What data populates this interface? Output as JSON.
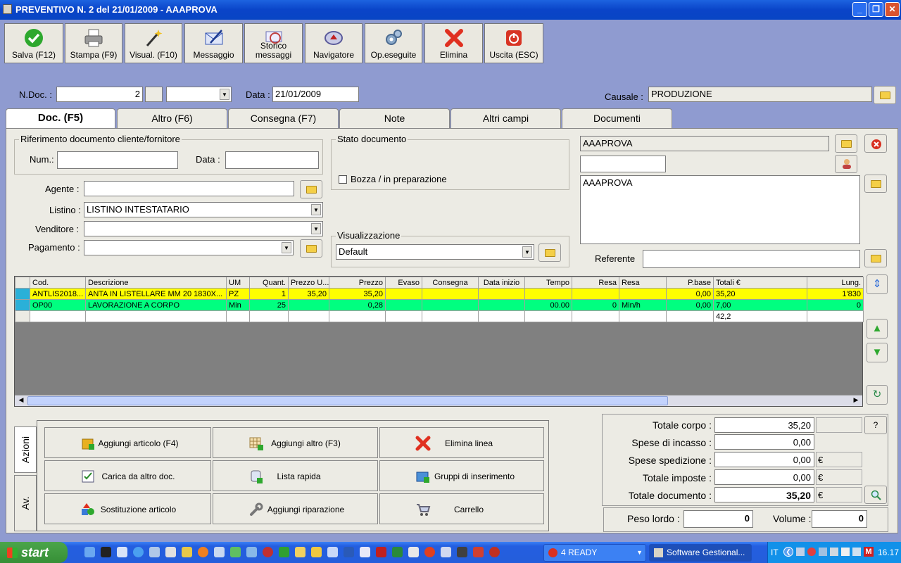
{
  "window": {
    "title": "PREVENTIVO N. 2  del 21/01/2009 - AAAPROVA",
    "min": "_",
    "max": "❐",
    "close": "✕"
  },
  "toolbar": [
    {
      "label": "Salva (F12)",
      "icon": "check-icon",
      "color": "#2ea82e"
    },
    {
      "label": "Stampa (F9)",
      "icon": "printer-icon",
      "color": "#6a6a6a"
    },
    {
      "label": "Visual. (F10)",
      "icon": "magic-wand-icon",
      "color": "#b08a18"
    },
    {
      "label": "Messaggio",
      "icon": "envelope-icon",
      "color": "#3656b5"
    },
    {
      "label": "Storico messaggi",
      "icon": "history-envelope-icon",
      "color": "#6a6fb5"
    },
    {
      "label": "Navigatore",
      "icon": "compass-icon",
      "color": "#5a5a9a"
    },
    {
      "label": "Op.eseguite",
      "icon": "gears-icon",
      "color": "#5078a8"
    },
    {
      "label": "Elimina",
      "icon": "x-icon",
      "color": "#e03020"
    },
    {
      "label": "Uscita (ESC)",
      "icon": "power-icon",
      "color": "#d83424"
    }
  ],
  "header": {
    "ndoc_label": "N.Doc. :",
    "ndoc_value": "2",
    "data_label": "Data :",
    "data_value": "21/01/2009",
    "causale_label": "Causale :",
    "causale_value": "PRODUZIONE"
  },
  "tabs": [
    "Doc. (F5)",
    "Altro (F6)",
    "Consegna (F7)",
    "Note",
    "Altri campi",
    "Documenti"
  ],
  "riferimento": {
    "title": "Riferimento documento cliente/fornitore",
    "num_label": "Num.:",
    "data_label": "Data :"
  },
  "stato": {
    "title": "Stato documento",
    "bozza_label": "Bozza / in preparazione"
  },
  "visualizzazione": {
    "title": "Visualizzazione",
    "value": "Default"
  },
  "fields": {
    "agente_label": "Agente :",
    "listino_label": "Listino :",
    "listino_value": "LISTINO INTESTATARIO",
    "venditore_label": "Venditore :",
    "pagamento_label": "Pagamento :"
  },
  "cliente": {
    "name": "AAAPROVA",
    "address": "AAAPROVA",
    "referente_label": "Referente"
  },
  "grid": {
    "columns": [
      "Cod.",
      "Descrizione",
      "UM",
      "Quant.",
      "Prezzo U...",
      "Prezzo",
      "Evaso",
      "Consegna",
      "Data inizio",
      "Tempo",
      "Resa",
      "Resa",
      "P.base",
      "Totali €",
      "Lung."
    ],
    "rows": [
      [
        "ANTLIS2018...",
        "ANTA IN LISTELLARE MM 20 1830X...",
        "PZ",
        "1",
        "35,20",
        "35,20",
        "",
        "",
        "",
        "",
        "",
        "",
        "0,00",
        "35,20",
        "1'830"
      ],
      [
        "OP00",
        "LAVORAZIONE A CORPO",
        "Min",
        "25",
        "",
        "0,28",
        "",
        "",
        "",
        "00.00",
        "0",
        "Min/h",
        "0,00",
        "7,00",
        "0"
      ],
      [
        "",
        "",
        "",
        "",
        "",
        "",
        "",
        "",
        "",
        "",
        "",
        "",
        "",
        "42,2",
        ""
      ]
    ]
  },
  "actions": {
    "tab_azioni": "Azioni",
    "tab_av": "Av.",
    "buttons": [
      {
        "label": "Aggiungi articolo (F4)",
        "icon": "box-add-icon"
      },
      {
        "label": "Aggiungi altro (F3)",
        "icon": "grid-add-icon"
      },
      {
        "label": "Elimina linea",
        "icon": "x-icon"
      },
      {
        "label": "Carica da altro doc.",
        "icon": "checklist-icon"
      },
      {
        "label": "Lista rapida",
        "icon": "scroll-add-icon"
      },
      {
        "label": "Gruppi di inserimento",
        "icon": "group-add-icon"
      },
      {
        "label": "Sostituzione articolo",
        "icon": "shapes-icon"
      },
      {
        "label": "Aggiungi riparazione",
        "icon": "wrench-icon"
      },
      {
        "label": "Carrello",
        "icon": "cart-icon"
      }
    ]
  },
  "totali": {
    "corpo_label": "Totale corpo :",
    "corpo": "35,20",
    "incasso_label": "Spese di incasso :",
    "incasso": "0,00",
    "spedizione_label": "Spese spedizione :",
    "spedizione": "0,00",
    "imposte_label": "Totale imposte :",
    "imposte": "0,00",
    "documento_label": "Totale documento :",
    "documento": "35,20",
    "euro": "€",
    "help": "?",
    "peso_label": "Peso lordo :",
    "peso": "0",
    "volume_label": "Volume :",
    "volume": "0"
  },
  "taskbar": {
    "start": "start",
    "task1": "4 READY",
    "task2": "Software Gestional...",
    "lang": "IT",
    "clock": "16.17"
  }
}
